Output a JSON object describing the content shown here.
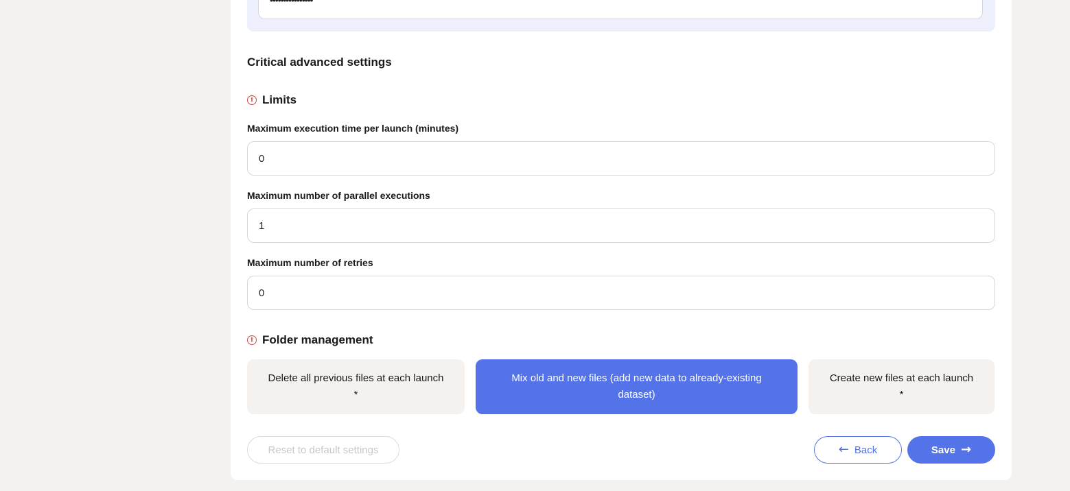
{
  "top_field": {
    "value": "••••••••••••••••"
  },
  "critical_section": {
    "title": "Critical advanced settings"
  },
  "limits": {
    "title": "Limits",
    "fields": [
      {
        "label": "Maximum execution time per launch (minutes)",
        "value": "0"
      },
      {
        "label": "Maximum number of parallel executions",
        "value": "1"
      },
      {
        "label": "Maximum number of retries",
        "value": "0"
      }
    ]
  },
  "folder_management": {
    "title": "Folder management",
    "options": [
      {
        "label": "Delete all previous files at each launch *",
        "selected": false
      },
      {
        "label": "Mix old and new files (add new data to already-existing dataset)",
        "selected": true
      },
      {
        "label": "Create new files at each launch *",
        "selected": false
      }
    ]
  },
  "actions": {
    "reset_label": "Reset to default settings",
    "back_label": "Back",
    "save_label": "Save"
  },
  "colors": {
    "accent": "#5473e8",
    "info_icon": "#d64545",
    "page_background": "#f4f1ee",
    "panel_tint": "#edf0fc"
  },
  "icons": {
    "info": "info-icon",
    "back_arrow": "arrow-left-icon",
    "save_arrow": "arrow-right-icon"
  }
}
